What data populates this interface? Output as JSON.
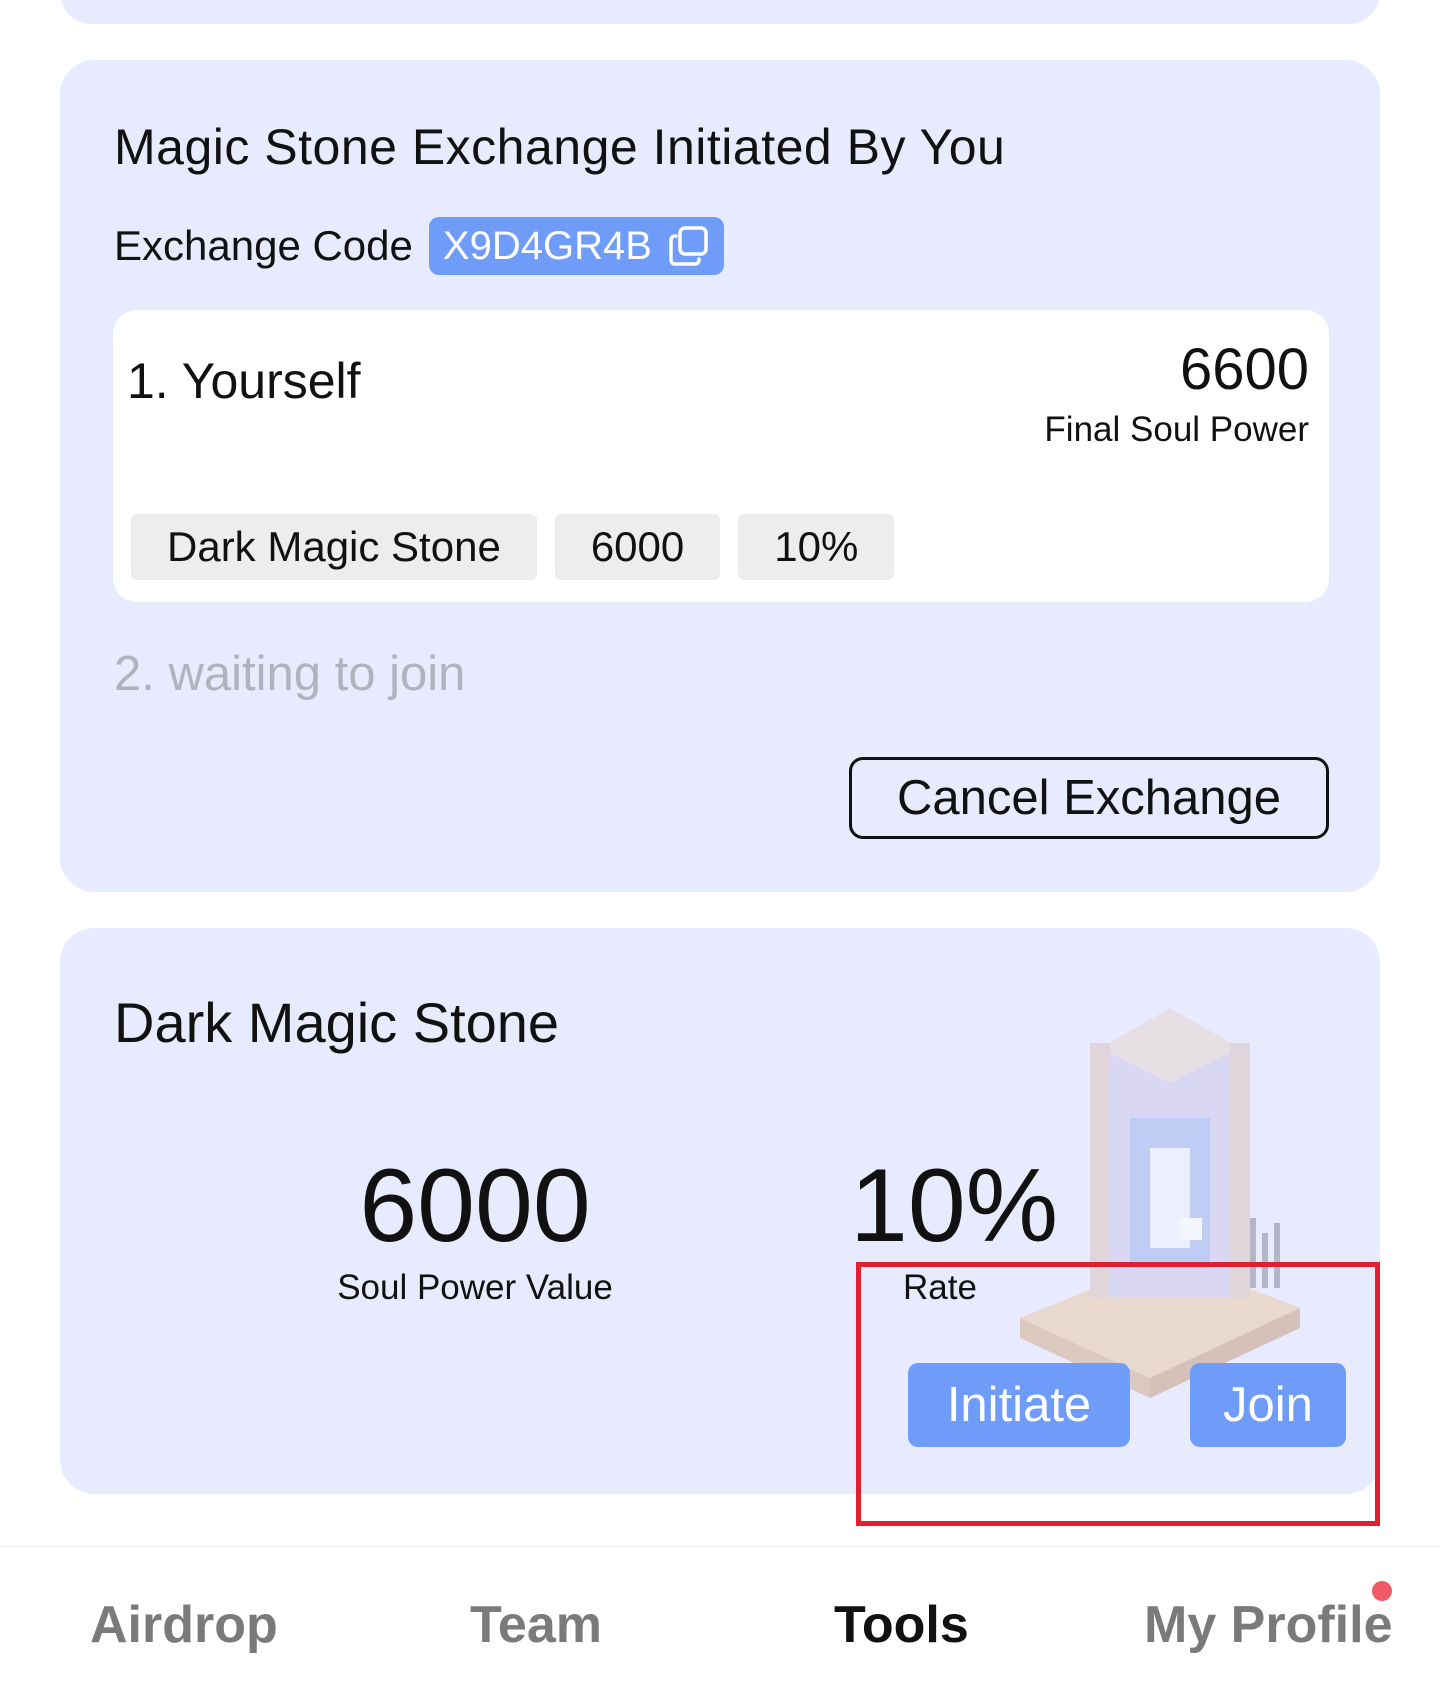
{
  "exchange": {
    "title": "Magic Stone Exchange Initiated By You",
    "code_label": "Exchange Code",
    "code_value": "X9D4GR4B",
    "copy_icon": "copy-icon",
    "member": {
      "name": "1. Yourself",
      "final_power": "6600",
      "final_power_label": "Final Soul Power",
      "stone_name": "Dark Magic Stone",
      "stone_value": "6000",
      "stone_rate": "10%"
    },
    "waiting": "2. waiting to join",
    "cancel_label": "Cancel Exchange"
  },
  "stone": {
    "title": "Dark Magic Stone",
    "soul_power_value": "6000",
    "soul_power_label": "Soul Power Value",
    "rate_value": "10%",
    "rate_label": "Rate",
    "initiate_label": "Initiate",
    "join_label": "Join",
    "art_icon": "stone-tower-illustration"
  },
  "tabs": [
    {
      "label": "Airdrop",
      "active": false
    },
    {
      "label": "Team",
      "active": false
    },
    {
      "label": "Tools",
      "active": true
    },
    {
      "label": "My Profile",
      "active": false,
      "notification": true
    }
  ],
  "colors": {
    "card_bg": "#e8ebfd",
    "accent_blue": "#6e9cf8",
    "highlight_red": "#e02030",
    "notification_dot": "#f05a67"
  }
}
